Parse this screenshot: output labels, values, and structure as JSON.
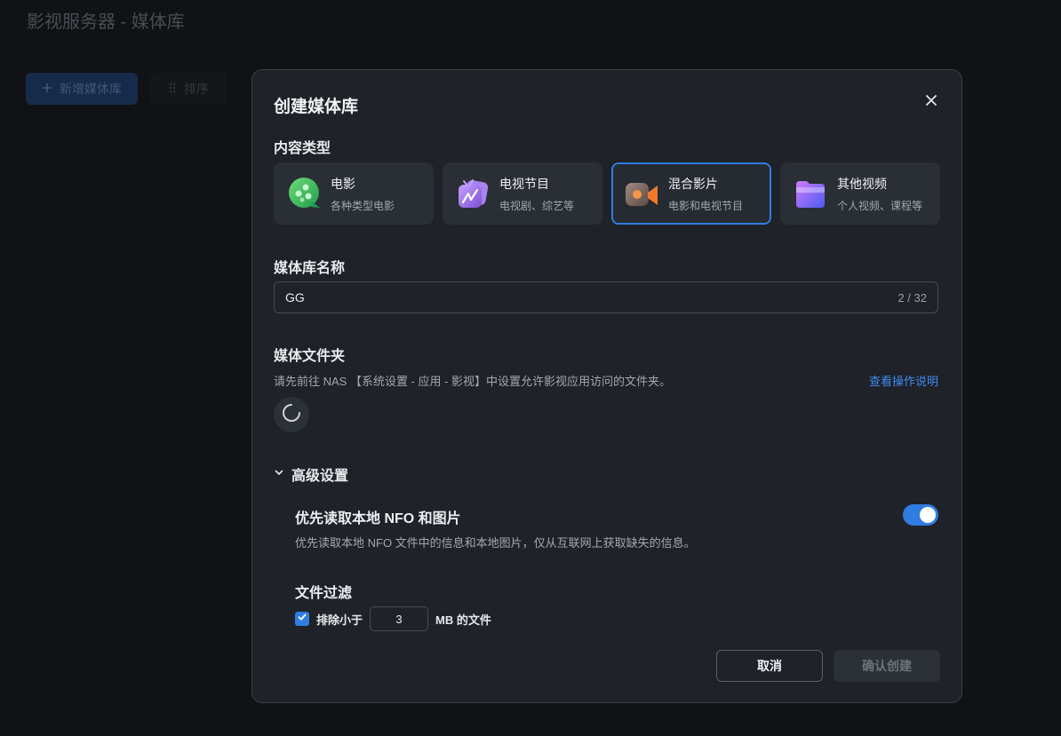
{
  "page": {
    "title": "影视服务器 - 媒体库",
    "toolbar": {
      "add_library_label": "新增媒体库",
      "sort_label": "排序"
    }
  },
  "modal": {
    "title": "创建媒体库",
    "content_type": {
      "label": "内容类型",
      "options": [
        {
          "name": "电影",
          "desc": "各种类型电影",
          "icon": "movie-icon",
          "selected": false
        },
        {
          "name": "电视节目",
          "desc": "电视剧、综艺等",
          "icon": "tv-icon",
          "selected": false
        },
        {
          "name": "混合影片",
          "desc": "电影和电视节目",
          "icon": "video-camera-icon",
          "selected": true
        },
        {
          "name": "其他视频",
          "desc": "个人视频、课程等",
          "icon": "folder-icon",
          "selected": false
        }
      ]
    },
    "library_name": {
      "label": "媒体库名称",
      "value": "GG",
      "count": "2 / 32"
    },
    "media_folder": {
      "label": "媒体文件夹",
      "hint": "请先前往 NAS 【系统设置 - 应用 - 影视】中设置允许影视应用访问的文件夹。",
      "help_link": "查看操作说明"
    },
    "advanced": {
      "label": "高级设置",
      "prefer_nfo": {
        "title": "优先读取本地 NFO 和图片",
        "desc": "优先读取本地 NFO 文件中的信息和本地图片，仅从互联网上获取缺失的信息。",
        "enabled": true
      },
      "file_filter": {
        "title": "文件过滤",
        "checked": true,
        "prefix": "排除小于",
        "size_value": "3",
        "suffix": "MB 的文件"
      }
    },
    "buttons": {
      "cancel": "取消",
      "confirm": "确认创建"
    }
  },
  "colors": {
    "accent": "#2f7de1",
    "link": "#3d8bf0",
    "modal_bg": "#1f2228",
    "page_bg": "#141619"
  }
}
